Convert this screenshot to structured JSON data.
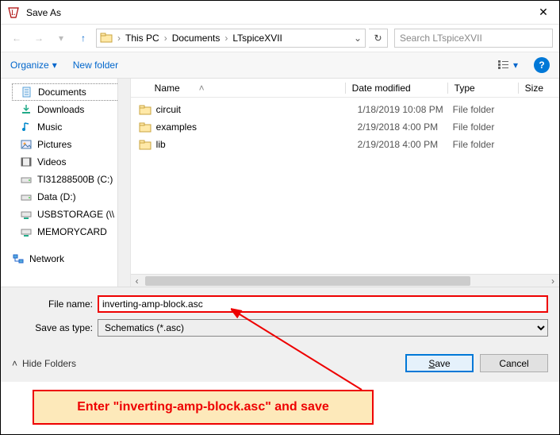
{
  "window": {
    "title": "Save As",
    "close": "✕"
  },
  "nav": {
    "back": "←",
    "forward": "→",
    "recent": "▾",
    "up": "↑"
  },
  "breadcrumbs": [
    "This PC",
    "Documents",
    "LTspiceXVII"
  ],
  "search": {
    "placeholder": "Search LTspiceXVII"
  },
  "toolbar": {
    "organize": "Organize",
    "newfolder": "New folder",
    "help": "?"
  },
  "tree": {
    "items": [
      {
        "label": "Documents",
        "icon": "doc",
        "selected": true
      },
      {
        "label": "Downloads",
        "icon": "down"
      },
      {
        "label": "Music",
        "icon": "music"
      },
      {
        "label": "Pictures",
        "icon": "pic"
      },
      {
        "label": "Videos",
        "icon": "vid"
      },
      {
        "label": "TI31288500B (C:)",
        "icon": "drive"
      },
      {
        "label": "Data (D:)",
        "icon": "drive"
      },
      {
        "label": "USBSTORAGE (\\\\",
        "icon": "netdrive"
      },
      {
        "label": "MEMORYCARD",
        "icon": "netdrive"
      },
      {
        "label": "",
        "icon": "",
        "spacer": true
      },
      {
        "label": "Network",
        "icon": "net"
      }
    ]
  },
  "columns": {
    "name": "Name",
    "date": "Date modified",
    "type": "Type",
    "size": "Size",
    "sortup": "˄"
  },
  "files": [
    {
      "name": "circuit",
      "date": "1/18/2019 10:08 PM",
      "type": "File folder"
    },
    {
      "name": "examples",
      "date": "2/19/2018 4:00 PM",
      "type": "File folder"
    },
    {
      "name": "lib",
      "date": "2/19/2018 4:00 PM",
      "type": "File folder"
    }
  ],
  "form": {
    "filename_label": "File name:",
    "filename_value": "inverting-amp-block.asc",
    "savetype_label": "Save as type:",
    "savetype_value": "Schematics (*.asc)"
  },
  "buttons": {
    "hide": "Hide Folders",
    "save": "Save",
    "cancel": "Cancel"
  },
  "annotation": {
    "text": "Enter \"inverting-amp-block.asc\" and save"
  }
}
